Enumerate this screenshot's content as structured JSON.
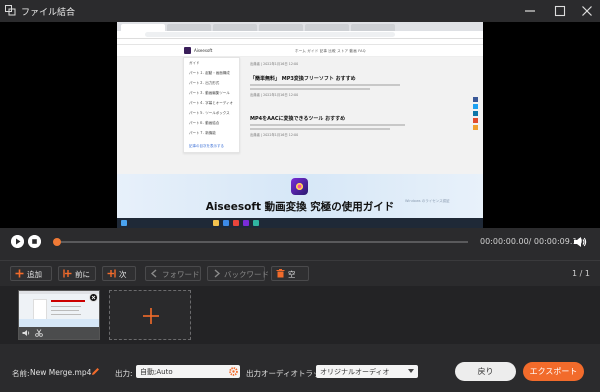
{
  "window": {
    "title": "ファイル結合",
    "icon": "merge-app-icon"
  },
  "preview": {
    "site_name": "Aiseesoft",
    "site_nav": "ホーム  ガイド  記事  比較  ストア  動画  FAQ",
    "side_menu": [
      "ガイド",
      "パート１. 起動・画面構成",
      "パート２. 出力形式",
      "パート３. 動画編集ツール",
      "パート４. 字幕とオーディオ",
      "パート５. ツールボックス",
      "パート６. 動画結合",
      "パート７. 新機能",
      "記事の目次を表示する"
    ],
    "articles": [
      {
        "title": "",
        "meta": "出典者  |  2022年1月16日  12:00"
      },
      {
        "title": "「簡単無料」 MP3変換フリーソフト おすすめ",
        "meta": "出典者  |  2022年1月16日  12:00"
      },
      {
        "title": "MP4をAACに変換できるツール おすすめ",
        "meta": "出典者  |  2022年1月16日  12:00"
      }
    ],
    "banner_text": "Aiseesoft 動画変換 究極の使用ガイド",
    "watermark": "Windows のライセンス認証"
  },
  "player": {
    "time": "00:00:00.00/ 00:00:09.19",
    "progress": 0.0
  },
  "toolbar": {
    "add": "追加",
    "prev": "前に",
    "next": "次",
    "forward": "フォワード",
    "backward": "バックワード",
    "clear": "空",
    "pager": "1 / 1"
  },
  "bottom": {
    "name_label": "名前:",
    "name_value": "New Merge.mp4",
    "output_label": "出力:",
    "output_value": "自動;Auto",
    "audio_label": "出力オーディオトラック:",
    "audio_value": "オリジナルオーディオ",
    "back_button": "戻り",
    "export_button": "エクスポート"
  },
  "colors": {
    "accent": "#f26b2b",
    "background": "#2b2b2d"
  }
}
